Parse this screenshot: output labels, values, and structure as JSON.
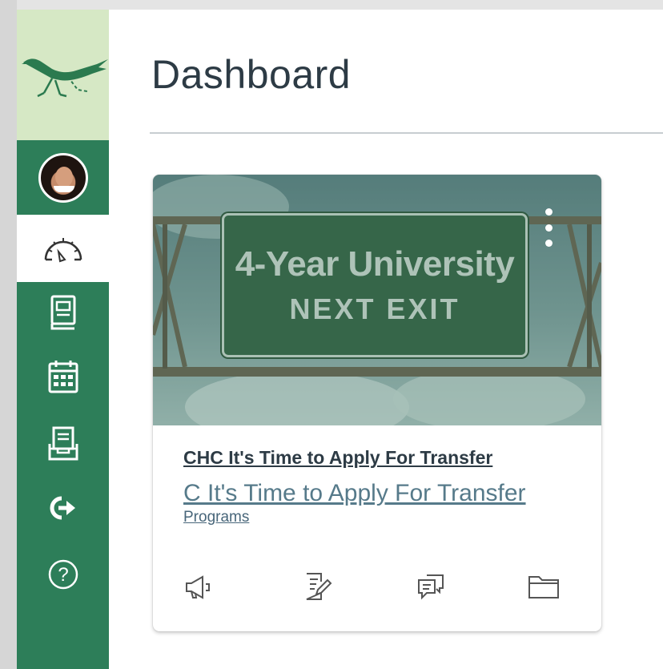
{
  "page": {
    "title": "Dashboard"
  },
  "nav": {
    "items": [
      {
        "name": "account",
        "icon": "avatar"
      },
      {
        "name": "dashboard",
        "icon": "speedometer-icon",
        "active": true
      },
      {
        "name": "courses",
        "icon": "book-icon"
      },
      {
        "name": "calendar",
        "icon": "calendar-icon"
      },
      {
        "name": "inbox",
        "icon": "inbox-icon"
      },
      {
        "name": "logout",
        "icon": "logout-arrow-icon"
      },
      {
        "name": "help",
        "icon": "help-circle-icon"
      }
    ]
  },
  "card": {
    "image_text_line1": "4-Year University",
    "image_text_line2": "NEXT EXIT",
    "course_title": "CHC It's Time to Apply For Transfer",
    "course_code": "C  It's Time to Apply For Transfer",
    "term": "Programs",
    "actions": [
      "announcements-icon",
      "assignments-icon",
      "discussions-icon",
      "files-icon"
    ]
  },
  "colors": {
    "nav_bg": "#2d7e59",
    "logo_bg": "#d6e8c5",
    "text_dark": "#2d3b45",
    "link_blue": "#567a8a"
  }
}
